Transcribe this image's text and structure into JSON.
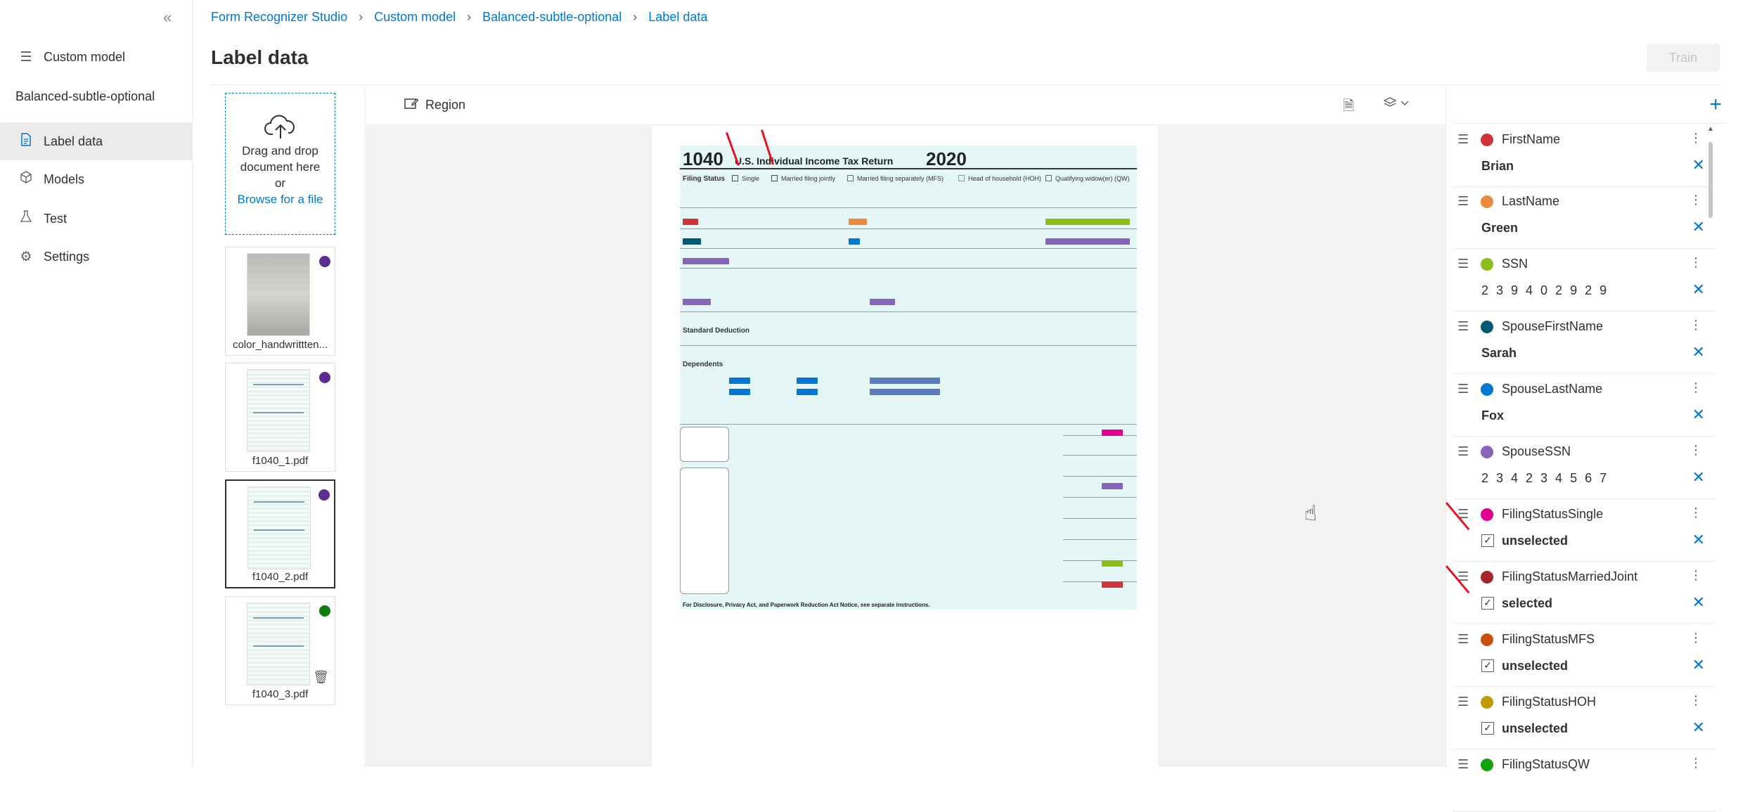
{
  "nav": {
    "items": [
      {
        "label": "Custom model",
        "icon": "menu-icon"
      },
      {
        "label": "Label data",
        "icon": "document-icon"
      },
      {
        "label": "Models",
        "icon": "cube-icon"
      },
      {
        "label": "Test",
        "icon": "flask-icon"
      },
      {
        "label": "Settings",
        "icon": "gear-icon"
      }
    ],
    "project": "Balanced-subtle-optional"
  },
  "breadcrumb": [
    "Form Recognizer Studio",
    "Custom model",
    "Balanced-subtle-optional",
    "Label data"
  ],
  "page_title": "Label data",
  "train_label": "Train",
  "upload": {
    "line1": "Drag and drop",
    "line2": "document here",
    "line3": "or",
    "browse": "Browse for a file"
  },
  "documents": [
    {
      "name": "color_handwrittten...",
      "dot_color": "#5c2d91"
    },
    {
      "name": "f1040_1.pdf",
      "dot_color": "#5c2d91"
    },
    {
      "name": "f1040_2.pdf",
      "dot_color": "#5c2d91"
    },
    {
      "name": "f1040_3.pdf",
      "dot_color": "#107c10"
    }
  ],
  "canvas_toolbar": {
    "region_label": "Region"
  },
  "form": {
    "number": "1040",
    "title": "U.S. Individual Income Tax Return",
    "year": "2020",
    "filing_status": "Filing Status",
    "options": [
      "Single",
      "Married filing jointly",
      "Married filing separately (MFS)",
      "Head of household (HOH)",
      "Qualifying widow(er) (QW)"
    ],
    "std_deduction": "Standard Deduction",
    "dependents": "Dependents",
    "footer": "For Disclosure, Privacy Act, and Paperwork Reduction Act Notice, see separate instructions."
  },
  "fields": [
    {
      "name": "FirstName",
      "color": "#d13438",
      "value": "Brian",
      "type": "text"
    },
    {
      "name": "LastName",
      "color": "#ea8a3c",
      "value": "Green",
      "type": "text"
    },
    {
      "name": "SSN",
      "color": "#8cbd18",
      "value": "2 3 9 4 0 2 9 2 9",
      "type": "text"
    },
    {
      "name": "SpouseFirstName",
      "color": "#005b70",
      "value": "Sarah",
      "type": "text"
    },
    {
      "name": "SpouseLastName",
      "color": "#0078d4",
      "value": "Fox",
      "type": "text"
    },
    {
      "name": "SpouseSSN",
      "color": "#8764b8",
      "value": "2 3 4 2 3 4 5 6 7",
      "type": "text"
    },
    {
      "name": "FilingStatusSingle",
      "color": "#e3008c",
      "value": "unselected",
      "type": "check"
    },
    {
      "name": "FilingStatusMarriedJoint",
      "color": "#a4262c",
      "value": "selected",
      "type": "check"
    },
    {
      "name": "FilingStatusMFS",
      "color": "#ca5010",
      "value": "unselected",
      "type": "check"
    },
    {
      "name": "FilingStatusHOH",
      "color": "#c19c00",
      "value": "unselected",
      "type": "check"
    },
    {
      "name": "FilingStatusQW",
      "color": "#13a10e",
      "value": "",
      "type": "check"
    }
  ]
}
